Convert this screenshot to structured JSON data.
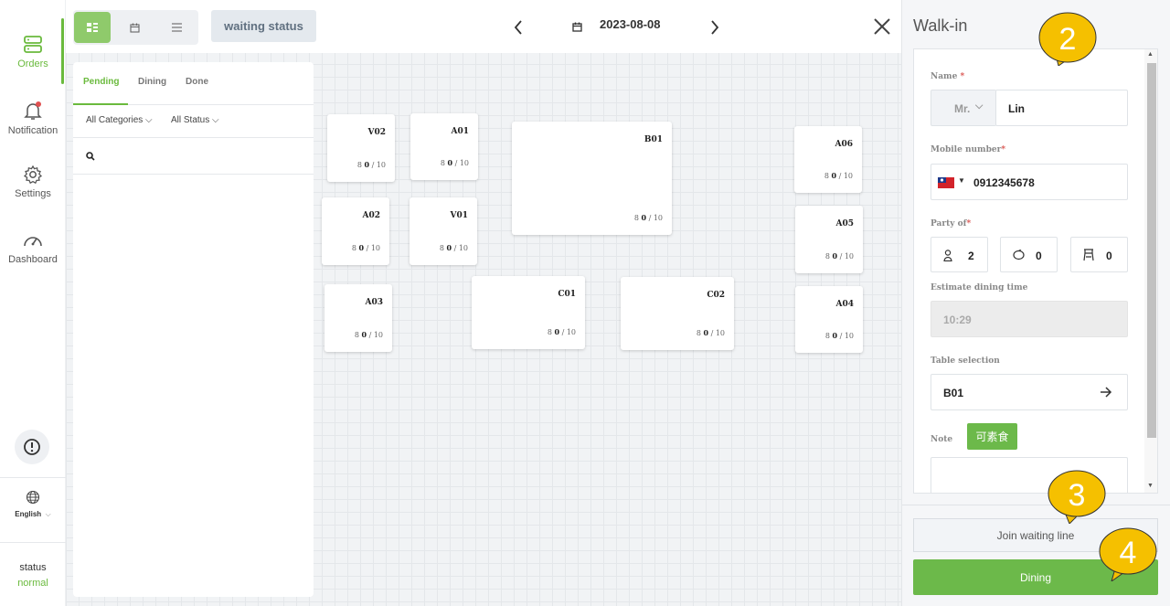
{
  "sidebar": {
    "items": [
      {
        "label": "Orders",
        "icon": "orders-icon"
      },
      {
        "label": "Notification",
        "icon": "bell-icon"
      },
      {
        "label": "Settings",
        "icon": "gear-icon"
      },
      {
        "label": "Dashboard",
        "icon": "gauge-icon"
      }
    ],
    "language": "English",
    "status_label": "status",
    "status_value": "normal"
  },
  "topbar": {
    "waiting_status": "waiting status",
    "date": "2023-08-08"
  },
  "left_panel": {
    "tabs": [
      "Pending",
      "Dining",
      "Done"
    ],
    "filters": [
      "All Categories",
      "All Status"
    ]
  },
  "tables": [
    {
      "name": "V02",
      "seated": "0",
      "capacity": "/ 10"
    },
    {
      "name": "A01",
      "seated": "0",
      "capacity": "/ 10"
    },
    {
      "name": "B01",
      "seated": "0",
      "capacity": "/ 10"
    },
    {
      "name": "A06",
      "seated": "0",
      "capacity": "/ 10"
    },
    {
      "name": "A02",
      "seated": "0",
      "capacity": "/ 10"
    },
    {
      "name": "V01",
      "seated": "0",
      "capacity": "/ 10"
    },
    {
      "name": "A05",
      "seated": "0",
      "capacity": "/ 10"
    },
    {
      "name": "A03",
      "seated": "0",
      "capacity": "/ 10"
    },
    {
      "name": "C01",
      "seated": "0",
      "capacity": "/ 10"
    },
    {
      "name": "C02",
      "seated": "0",
      "capacity": "/ 10"
    },
    {
      "name": "A04",
      "seated": "0",
      "capacity": "/ 10"
    }
  ],
  "walkin": {
    "title": "Walk-in",
    "name_label": "Name",
    "title_value": "Mr.",
    "name_value": "Lin",
    "mobile_label": "Mobile number",
    "mobile_value": "0912345678",
    "party_label": "Party of",
    "adults": "2",
    "children": "0",
    "high_chairs": "0",
    "estimate_label": "Estimate dining time",
    "estimate_value": "10:29",
    "table_label": "Table selection",
    "table_value": "B01",
    "note_label": "Note",
    "note_tag": "可素食",
    "join_label": "Join waiting line",
    "dining_label": "Dining"
  },
  "callouts": [
    "2",
    "3",
    "4"
  ],
  "colors": {
    "accent": "#6cb94a",
    "callout": "#f5c000"
  }
}
